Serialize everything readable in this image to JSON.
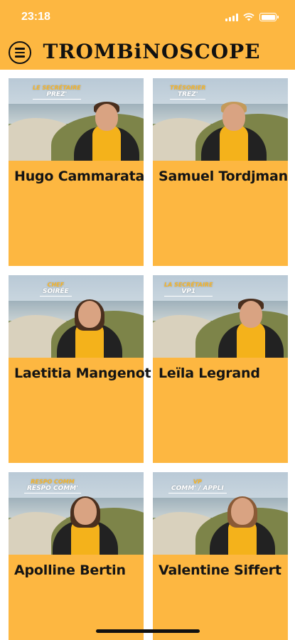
{
  "status_bar": {
    "time": "23:18"
  },
  "header": {
    "title": "TROMBiNOSCOPE",
    "menu_icon": "hamburger-circle-icon"
  },
  "colors": {
    "brand": "#fdb741",
    "card": "#fdb741",
    "text": "#141414"
  },
  "members": [
    {
      "name": "Hugo Cammarata",
      "badge_line1": "LE SECRÉTAIRE",
      "badge_line2": "PREZ'"
    },
    {
      "name": "Samuel Tordjman",
      "badge_line1": "TRÉSORIER",
      "badge_line2": "TREZ'"
    },
    {
      "name": "Laetitia Mangenot",
      "badge_line1": "CHEF",
      "badge_line2": "SOIRÉE"
    },
    {
      "name": "Leïla Legrand",
      "badge_line1": "LA SECRÉTAIRE",
      "badge_line2": "VP1"
    },
    {
      "name": "Apolline Bertin",
      "badge_line1": "RESPO COMM",
      "badge_line2": "RESPO COMM'"
    },
    {
      "name": "Valentine Siffert",
      "badge_line1": "VP",
      "badge_line2": "COMM' / APPLI"
    }
  ]
}
